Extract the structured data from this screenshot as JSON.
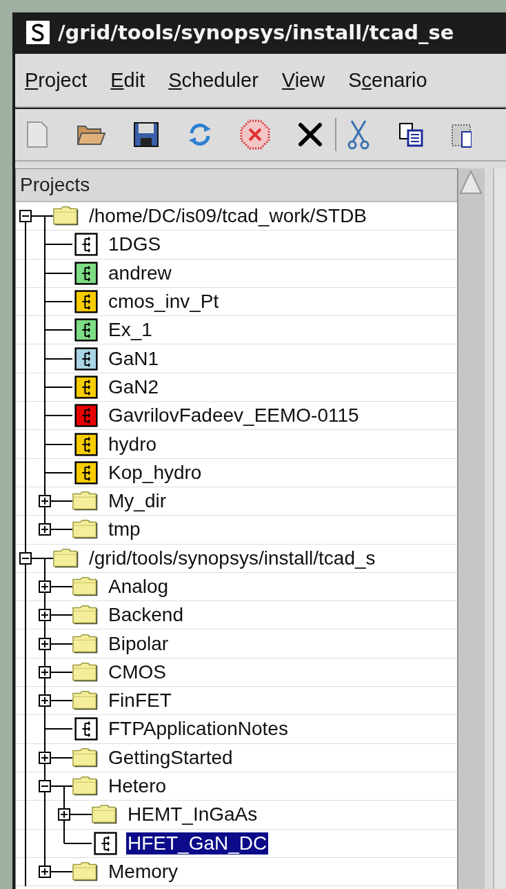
{
  "window": {
    "title": "/grid/tools/synopsys/install/tcad_se"
  },
  "menu": [
    {
      "key": "P",
      "after": "roject"
    },
    {
      "key": "E",
      "after": "dit"
    },
    {
      "key": "S",
      "after": "cheduler"
    },
    {
      "key": "V",
      "after": "iew"
    },
    {
      "before": "S",
      "key": "c",
      "after": "enario"
    }
  ],
  "tree": {
    "header": "Projects",
    "items": [
      {
        "kind": "folder",
        "label": "/home/DC/is09/tcad_work/STDB",
        "expanded": true,
        "selected": false,
        "children": [
          {
            "kind": "project",
            "label": "1DGS",
            "color": "#ffffff",
            "selected": false
          },
          {
            "kind": "project",
            "label": "andrew",
            "color": "#7ddc84",
            "selected": false
          },
          {
            "kind": "project",
            "label": "cmos_inv_Pt",
            "color": "#f7cc00",
            "selected": false
          },
          {
            "kind": "project",
            "label": "Ex_1",
            "color": "#7ddc84",
            "selected": false
          },
          {
            "kind": "project",
            "label": "GaN1",
            "color": "#a8d4e4",
            "selected": false
          },
          {
            "kind": "project",
            "label": "GaN2",
            "color": "#f7cc00",
            "selected": false
          },
          {
            "kind": "project",
            "label": "GavrilovFadeev_EEMO-0115",
            "color": "#e80000",
            "selected": false
          },
          {
            "kind": "project",
            "label": "hydro",
            "color": "#f7cc00",
            "selected": false
          },
          {
            "kind": "project",
            "label": "Kop_hydro",
            "color": "#f7cc00",
            "selected": false
          },
          {
            "kind": "folder",
            "label": "My_dir",
            "expanded": false,
            "selected": false
          },
          {
            "kind": "folder",
            "label": "tmp",
            "expanded": false,
            "selected": false
          }
        ]
      },
      {
        "kind": "folder",
        "label": "/grid/tools/synopsys/install/tcad_s",
        "expanded": true,
        "selected": false,
        "children": [
          {
            "kind": "folder",
            "label": "Analog",
            "expanded": false,
            "selected": false
          },
          {
            "kind": "folder",
            "label": "Backend",
            "expanded": false,
            "selected": false
          },
          {
            "kind": "folder",
            "label": "Bipolar",
            "expanded": false,
            "selected": false
          },
          {
            "kind": "folder",
            "label": "CMOS",
            "expanded": false,
            "selected": false
          },
          {
            "kind": "folder",
            "label": "FinFET",
            "expanded": false,
            "selected": false
          },
          {
            "kind": "project",
            "label": "FTPApplicationNotes",
            "color": "#ffffff",
            "selected": false
          },
          {
            "kind": "folder",
            "label": "GettingStarted",
            "expanded": false,
            "selected": false
          },
          {
            "kind": "folder",
            "label": "Hetero",
            "expanded": true,
            "selected": false,
            "children": [
              {
                "kind": "folder",
                "label": "HEMT_InGaAs",
                "expanded": false,
                "selected": false
              },
              {
                "kind": "project",
                "label": "HFET_GaN_DC",
                "color": "#ffffff",
                "selected": true
              }
            ]
          },
          {
            "kind": "folder",
            "label": "Memory",
            "expanded": false,
            "selected": false
          }
        ]
      }
    ]
  }
}
